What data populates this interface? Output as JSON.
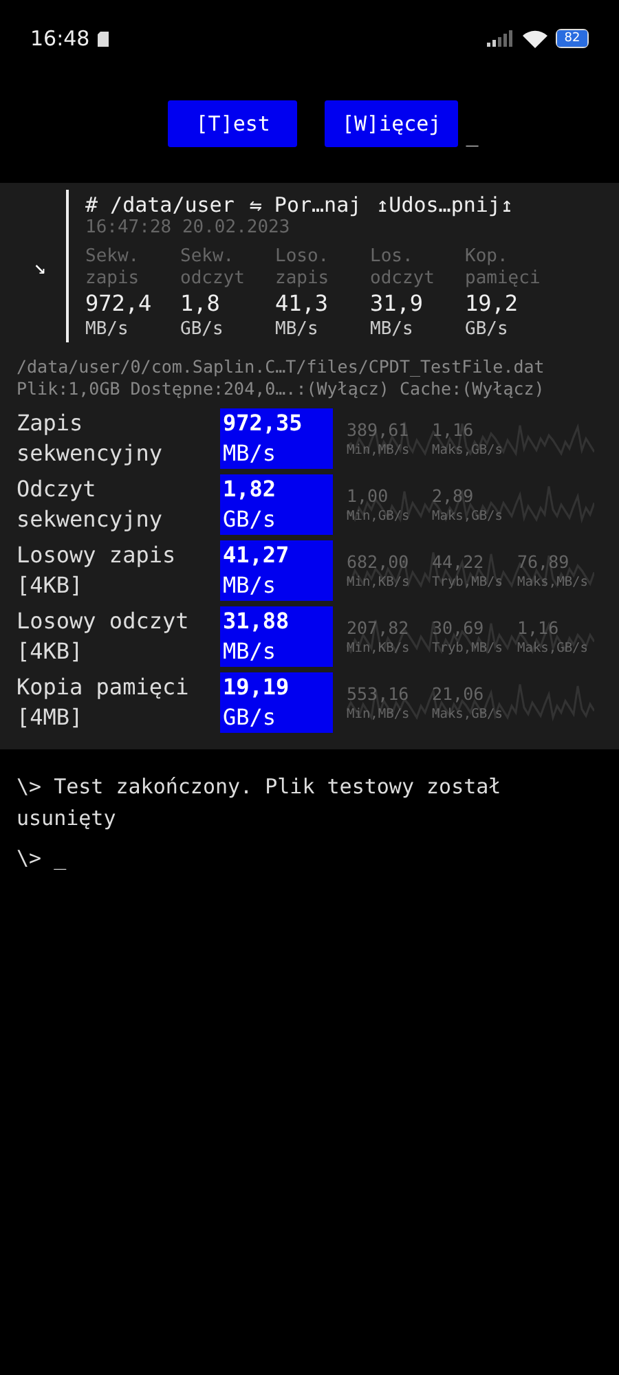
{
  "status_bar": {
    "time": "16:48",
    "battery": "82"
  },
  "buttons": [
    {
      "label": "[T]est"
    },
    {
      "label": "[W]ięcej"
    }
  ],
  "cursor": "_",
  "summary": {
    "arrow": "↘",
    "path": "# /data/user",
    "compare": "⇋ Por…naj",
    "share": "↥Udos…pnij↥",
    "timestamp": "16:47:28 20.02.2023",
    "columns": [
      {
        "label": "Sekw. zapis",
        "value": "972,4",
        "unit": "MB/s"
      },
      {
        "label": "Sekw. odczyt",
        "value": "1,8",
        "unit": "GB/s"
      },
      {
        "label": "Loso. zapis",
        "value": "41,3",
        "unit": "MB/s"
      },
      {
        "label": "Los. odczyt",
        "value": "31,9",
        "unit": "MB/s"
      },
      {
        "label": "Kop. pamięci",
        "value": "19,2",
        "unit": "GB/s"
      }
    ]
  },
  "file": {
    "path": "/data/user/0/com.Saplin.C…T/files/CPDT_TestFile.dat",
    "info": "Plik:1,0GB Dostępne:204,0….:(Wyłącz) Cache:(Wyłącz)"
  },
  "results": [
    {
      "name": "Zapis sekwencyjny",
      "value": "972,35",
      "unit": "MB/s",
      "stats": [
        {
          "value": "389,61",
          "label": "Min,MB/s"
        },
        {
          "value": "1,16",
          "label": "Maks,GB/s"
        }
      ]
    },
    {
      "name": "Odczyt sekwencyjny",
      "value": "1,82",
      "unit": "GB/s",
      "stats": [
        {
          "value": "1,00",
          "label": "Min,GB/s"
        },
        {
          "value": "2,89",
          "label": "Maks,GB/s"
        }
      ]
    },
    {
      "name": "Losowy zapis [4KB]",
      "value": "41,27",
      "unit": "MB/s",
      "stats": [
        {
          "value": "682,00",
          "label": "Min,KB/s"
        },
        {
          "value": "44,22",
          "label": "Tryb,MB/s"
        },
        {
          "value": "76,89",
          "label": "Maks,MB/s"
        }
      ]
    },
    {
      "name": "Losowy odczyt [4KB]",
      "value": "31,88",
      "unit": "MB/s",
      "stats": [
        {
          "value": "207,82",
          "label": "Min,KB/s"
        },
        {
          "value": "30,69",
          "label": "Tryb,MB/s"
        },
        {
          "value": "1,16",
          "label": "Maks,GB/s"
        }
      ]
    },
    {
      "name": "Kopia pamięci [4MB]",
      "value": "19,19",
      "unit": "GB/s",
      "stats": [
        {
          "value": "553,16",
          "label": "Min,MB/s"
        },
        {
          "value": "21,06",
          "label": "Maks,GB/s"
        }
      ]
    }
  ],
  "terminal": [
    "\\> Test zakończony. Plik testowy został usunięty",
    "\\> _"
  ]
}
